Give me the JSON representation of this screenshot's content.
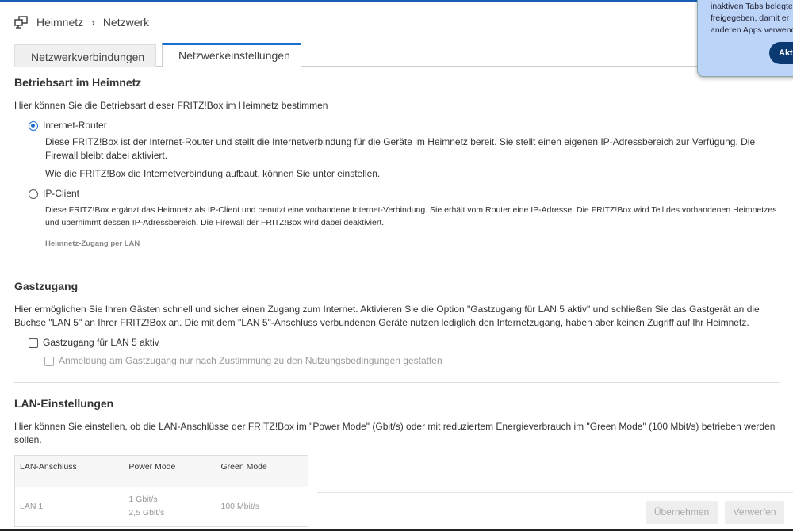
{
  "breadcrumb": {
    "home": "Heimnetz",
    "current": "Netzwerk"
  },
  "tabs": [
    {
      "label": "Netzwerkverbindungen"
    },
    {
      "label": "Netzwerkeinstellungen"
    }
  ],
  "popup": {
    "lines": [
      "inaktiven Tabs belegter",
      "freigegeben, damit er",
      "anderen Apps verwende"
    ],
    "button": "Akti"
  },
  "betriebsart": {
    "title": "Betriebsart im Heimnetz",
    "intro": "Hier können Sie die Betriebsart dieser FRITZ!Box im Heimnetz bestimmen",
    "router_label": "Internet-Router",
    "router_desc": "Diese FRITZ!Box ist der Internet-Router und stellt die Internetverbindung für die Geräte im Heimnetz bereit. Sie stellt einen eigenen IP-Adressbereich zur Verfügung. Die Firewall bleibt dabei aktiviert.",
    "router_desc2": "Wie die FRITZ!Box die Internetverbindung aufbaut, können Sie unter einstellen.",
    "client_label": "IP-Client",
    "client_desc": "Diese FRITZ!Box ergänzt das Heimnetz als IP-Client und benutzt eine vorhandene Internet-Verbindung. Sie erhält vom Router eine IP-Adresse. Die FRITZ!Box wird Teil des vorhandenen Heimnetzes und übernimmt dessen IP-Adressbereich. Die Firewall der FRITZ!Box wird dabei deaktiviert.",
    "client_sub": "Heimnetz-Zugang per LAN"
  },
  "gast": {
    "title": "Gastzugang",
    "intro": "Hier ermöglichen Sie Ihren Gästen schnell und sicher einen Zugang zum Internet. Aktivieren Sie die Option \"Gastzugang für LAN 5 aktiv\" und schließen Sie das Gastgerät an die Buchse \"LAN 5\" an Ihrer FRITZ!Box an. Die mit dem \"LAN 5\"-Anschluss verbundenen Geräte nutzen lediglich den Internetzugang, haben aber keinen Zugriff auf Ihr Heimnetz.",
    "cb1": "Gastzugang für LAN 5 aktiv",
    "cb2": "Anmeldung am Gastzugang nur nach Zustimmung zu den Nutzungsbedingungen gestatten"
  },
  "lan": {
    "title": "LAN-Einstellungen",
    "intro": "Hier können Sie einstellen, ob die LAN-Anschlüsse der FRITZ!Box im \"Power Mode\" (Gbit/s) oder mit reduziertem Energieverbrauch im \"Green Mode\" (100 Mbit/s) betrieben werden sollen.",
    "headers": [
      "LAN-Anschluss",
      "Power Mode",
      "Green Mode"
    ],
    "row": {
      "port": "LAN 1",
      "power1": "1 Gbit/s",
      "power2": "2,5 Gbit/s",
      "green": "100 Mbit/s"
    }
  },
  "actions": {
    "apply": "Übernehmen",
    "discard": "Verwerfen"
  }
}
